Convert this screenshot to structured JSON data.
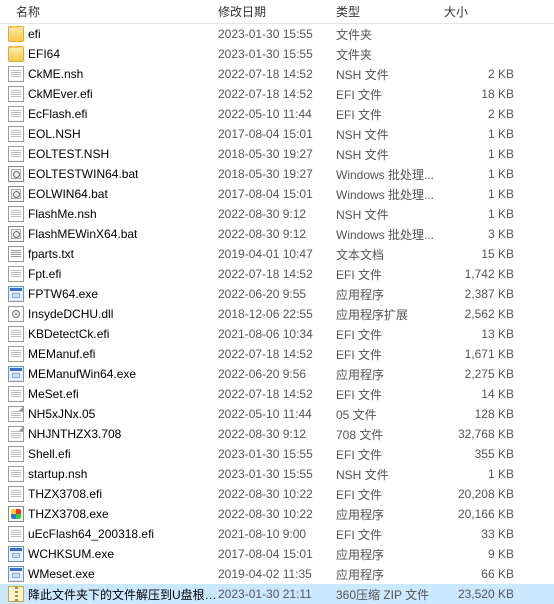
{
  "columns": {
    "name": "名称",
    "date": "修改日期",
    "type": "类型",
    "size": "大小"
  },
  "files": [
    {
      "icon": "ico-folder",
      "name": "efi",
      "date": "2023-01-30 15:55",
      "type": "文件夹",
      "size": ""
    },
    {
      "icon": "ico-folder",
      "name": "EFI64",
      "date": "2023-01-30 15:55",
      "type": "文件夹",
      "size": ""
    },
    {
      "icon": "ico-nsh",
      "name": "CkME.nsh",
      "date": "2022-07-18 14:52",
      "type": "NSH 文件",
      "size": "2 KB"
    },
    {
      "icon": "ico-efi",
      "name": "CkMEver.efi",
      "date": "2022-07-18 14:52",
      "type": "EFI 文件",
      "size": "18 KB"
    },
    {
      "icon": "ico-efi",
      "name": "EcFlash.efi",
      "date": "2022-05-10 11:44",
      "type": "EFI 文件",
      "size": "2 KB"
    },
    {
      "icon": "ico-nsh",
      "name": "EOL.NSH",
      "date": "2017-08-04 15:01",
      "type": "NSH 文件",
      "size": "1 KB"
    },
    {
      "icon": "ico-nsh",
      "name": "EOLTEST.NSH",
      "date": "2018-05-30 19:27",
      "type": "NSH 文件",
      "size": "1 KB"
    },
    {
      "icon": "ico-bat",
      "name": "EOLTESTWIN64.bat",
      "date": "2018-05-30 19:27",
      "type": "Windows 批处理...",
      "size": "1 KB"
    },
    {
      "icon": "ico-bat",
      "name": "EOLWIN64.bat",
      "date": "2017-08-04 15:01",
      "type": "Windows 批处理...",
      "size": "1 KB"
    },
    {
      "icon": "ico-nsh",
      "name": "FlashMe.nsh",
      "date": "2022-08-30 9:12",
      "type": "NSH 文件",
      "size": "1 KB"
    },
    {
      "icon": "ico-bat",
      "name": "FlashMEWinX64.bat",
      "date": "2022-08-30 9:12",
      "type": "Windows 批处理...",
      "size": "3 KB"
    },
    {
      "icon": "ico-txt",
      "name": "fparts.txt",
      "date": "2019-04-01 10:47",
      "type": "文本文档",
      "size": "15 KB"
    },
    {
      "icon": "ico-efi",
      "name": "Fpt.efi",
      "date": "2022-07-18 14:52",
      "type": "EFI 文件",
      "size": "1,742 KB"
    },
    {
      "icon": "ico-exe",
      "name": "FPTW64.exe",
      "date": "2022-06-20 9:55",
      "type": "应用程序",
      "size": "2,387 KB"
    },
    {
      "icon": "ico-dll",
      "name": "InsydeDCHU.dll",
      "date": "2018-12-06 22:55",
      "type": "应用程序扩展",
      "size": "2,562 KB"
    },
    {
      "icon": "ico-efi",
      "name": "KBDetectCk.efi",
      "date": "2021-08-06 10:34",
      "type": "EFI 文件",
      "size": "13 KB"
    },
    {
      "icon": "ico-efi",
      "name": "MEManuf.efi",
      "date": "2022-07-18 14:52",
      "type": "EFI 文件",
      "size": "1,671 KB"
    },
    {
      "icon": "ico-exe",
      "name": "MEManufWin64.exe",
      "date": "2022-06-20 9:56",
      "type": "应用程序",
      "size": "2,275 KB"
    },
    {
      "icon": "ico-efi",
      "name": "MeSet.efi",
      "date": "2022-07-18 14:52",
      "type": "EFI 文件",
      "size": "14 KB"
    },
    {
      "icon": "ico-file",
      "name": "NH5xJNx.05",
      "date": "2022-05-10 11:44",
      "type": "05 文件",
      "size": "128 KB"
    },
    {
      "icon": "ico-file",
      "name": "NHJNTHZX3.708",
      "date": "2022-08-30 9:12",
      "type": "708 文件",
      "size": "32,768 KB"
    },
    {
      "icon": "ico-efi",
      "name": "Shell.efi",
      "date": "2023-01-30 15:55",
      "type": "EFI 文件",
      "size": "355 KB"
    },
    {
      "icon": "ico-nsh",
      "name": "startup.nsh",
      "date": "2023-01-30 15:55",
      "type": "NSH 文件",
      "size": "1 KB"
    },
    {
      "icon": "ico-efi",
      "name": "THZX3708.efi",
      "date": "2022-08-30 10:22",
      "type": "EFI 文件",
      "size": "20,208 KB"
    },
    {
      "icon": "ico-exe2",
      "name": "THZX3708.exe",
      "date": "2022-08-30 10:22",
      "type": "应用程序",
      "size": "20,166 KB"
    },
    {
      "icon": "ico-efi",
      "name": "uEcFlash64_200318.efi",
      "date": "2021-08-10 9:00",
      "type": "EFI 文件",
      "size": "33 KB"
    },
    {
      "icon": "ico-exe",
      "name": "WCHKSUM.exe",
      "date": "2017-08-04 15:01",
      "type": "应用程序",
      "size": "9 KB"
    },
    {
      "icon": "ico-exe",
      "name": "WMeset.exe",
      "date": "2019-04-02 11:35",
      "type": "应用程序",
      "size": "66 KB"
    },
    {
      "icon": "ico-zip",
      "name": "降此文件夹下的文件解压到U盘根目录.zip",
      "date": "2023-01-30 21:11",
      "type": "360压缩 ZIP 文件",
      "size": "23,520 KB",
      "selected": true
    }
  ]
}
